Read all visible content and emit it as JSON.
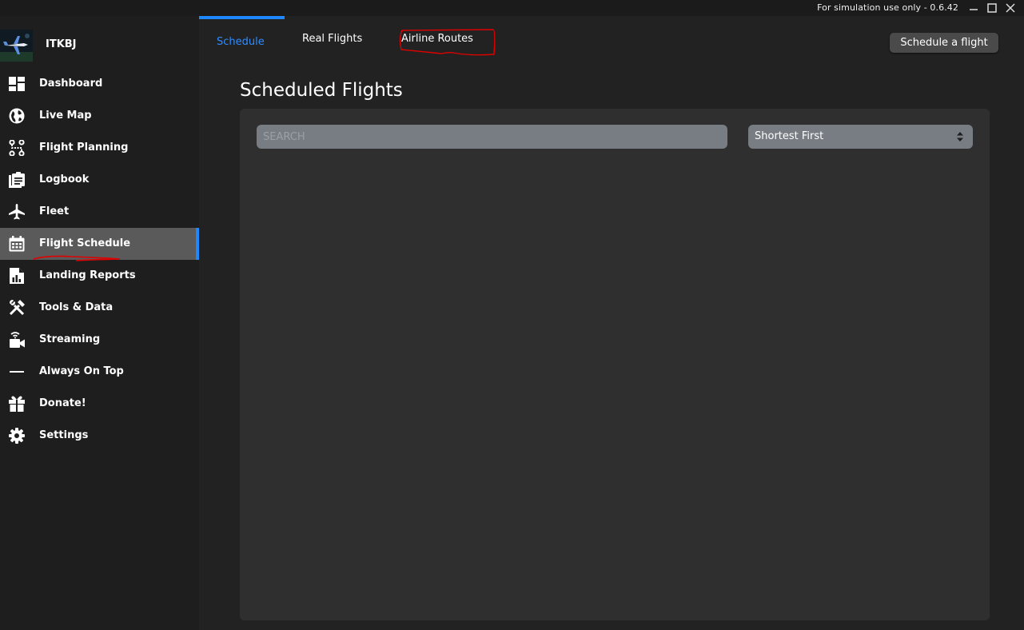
{
  "window": {
    "version_text": "For simulation use only - 0.6.42",
    "controls": [
      "minimize-icon",
      "maximize-icon",
      "close-icon"
    ]
  },
  "profile": {
    "username": "ITKBJ"
  },
  "sidebar": {
    "items": [
      {
        "label": "Dashboard",
        "icon": "dashboard-icon"
      },
      {
        "label": "Live Map",
        "icon": "globe-icon"
      },
      {
        "label": "Flight Planning",
        "icon": "route-icon"
      },
      {
        "label": "Logbook",
        "icon": "clipboard-icon"
      },
      {
        "label": "Fleet",
        "icon": "airplane-icon"
      },
      {
        "label": "Flight Schedule",
        "icon": "calendar-icon",
        "active": true
      },
      {
        "label": "Landing Reports",
        "icon": "report-icon"
      },
      {
        "label": "Tools & Data",
        "icon": "tools-icon"
      },
      {
        "label": "Streaming",
        "icon": "video-icon"
      },
      {
        "label": "Always On Top",
        "icon": "dash-icon"
      },
      {
        "label": "Donate!",
        "icon": "gift-icon"
      },
      {
        "label": "Settings",
        "icon": "gear-icon"
      }
    ]
  },
  "tabs": [
    {
      "label": "Schedule",
      "active": true
    },
    {
      "label": "Real Flights",
      "active": false
    },
    {
      "label": "Airline Routes",
      "active": false
    }
  ],
  "header": {
    "schedule_button": "Schedule a flight"
  },
  "main": {
    "title": "Scheduled Flights",
    "search_placeholder": "SEARCH",
    "sort_selected": "Shortest First"
  },
  "colors": {
    "accent": "#1e88ff",
    "background": "#222222",
    "sidebar": "#1e1e1e",
    "panel": "#2f2f2f",
    "input": "#777d82",
    "annotation": "#e00000"
  }
}
